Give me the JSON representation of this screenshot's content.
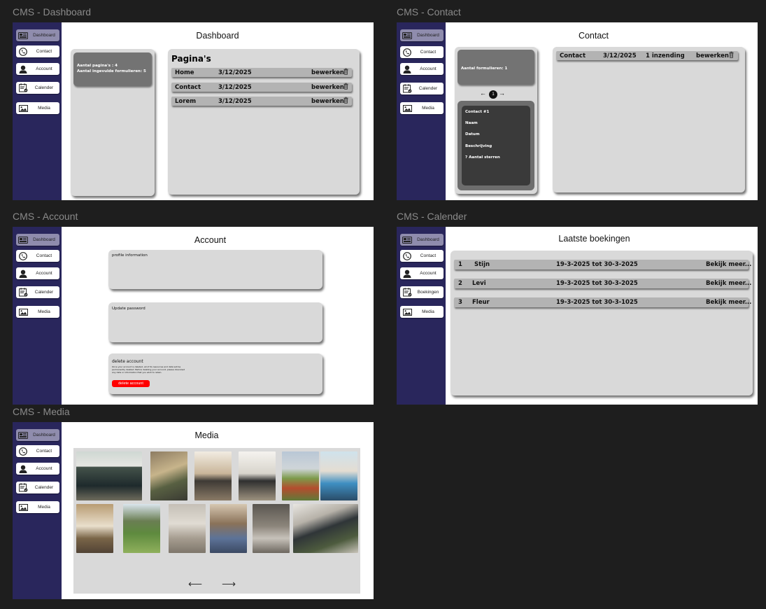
{
  "frames": {
    "dashboard": "CMS - Dashboard",
    "contact": "CMS - Contact",
    "account": "CMS - Account",
    "calender": "CMS - Calender",
    "media": "CMS - Media"
  },
  "nav": {
    "dashboard": "Dashboard",
    "contact": "Contact",
    "account": "Account",
    "calender": "Calender",
    "boekingen": "Boekingen",
    "media": "Media"
  },
  "dashboard": {
    "title": "Dashboard",
    "stats_pages": "Aantal pagina's : 4",
    "stats_forms": "Aantal ingevulde formulieren: 5",
    "pages_heading": "Pagina's",
    "rows": [
      {
        "name": "Home",
        "date": "3/12/2025",
        "action": "bewerken"
      },
      {
        "name": "Contact",
        "date": "3/12/2025",
        "action": "bewerken"
      },
      {
        "name": "Lorem",
        "date": "3/12/2025",
        "action": "bewerken"
      }
    ]
  },
  "contact": {
    "title": "Contact",
    "forms_count": "Aantal formulieren: 1",
    "pager_left": "←",
    "pager_page": "1",
    "pager_right": "→",
    "card": {
      "title": "Contact #1",
      "name": "Naam",
      "date": "Datum",
      "description": "Beschrijving",
      "stars": "? Aantal sterren"
    },
    "row": {
      "name": "Contact",
      "date": "3/12/2025",
      "count": "1 inzending",
      "action": "bewerken"
    }
  },
  "account": {
    "title": "Account",
    "profile": "profile information",
    "password": "Update password",
    "delete_title": "delete account",
    "delete_text": "Once your account is deleted, all of its resources and data will be permanently deleted. Before deleting your account, please download any data or information that you wish to retain.",
    "delete_button": "delete account",
    "delete_color": "#ff0000"
  },
  "calender": {
    "title": "Laatste boekingen",
    "rows": [
      {
        "num": "1",
        "name": "Stijn",
        "dates": "19-3-2025 tot 30-3-2025",
        "action": "Bekijk meer..."
      },
      {
        "num": "2",
        "name": "Levi",
        "dates": "19-3-2025 tot 30-3-2025",
        "action": "Bekijk meer..."
      },
      {
        "num": "3",
        "name": "Fleur",
        "dates": "19-3-2025 tot 30-3-1025",
        "action": "Bekijk meer..."
      }
    ]
  },
  "media": {
    "title": "Media",
    "prev": "⟵",
    "next": "⟶",
    "photos": [
      "house-exterior",
      "living-room",
      "dining-table",
      "dining-corner",
      "garden",
      "kitchen",
      "bedroom-loft",
      "garden-lawn",
      "shower",
      "living-fireplace",
      "bathroom",
      "garden-terrace"
    ]
  },
  "colors": {
    "sidebar": "#29265c",
    "active_nav": "#8f8cad",
    "panel": "#d9d9d9",
    "row": "#b3b3b3",
    "dark_card": "#3a3a3a"
  }
}
